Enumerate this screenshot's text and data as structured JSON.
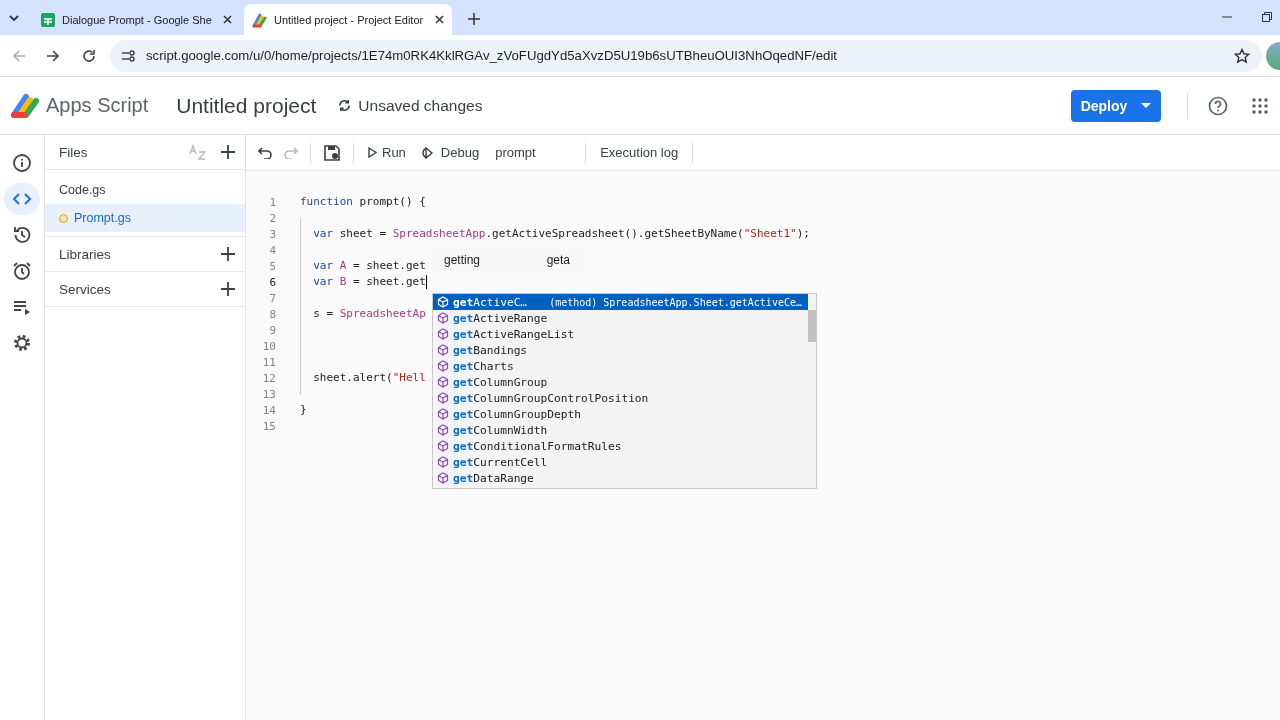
{
  "browser": {
    "tabs": [
      {
        "title": "Dialogue Prompt - Google She",
        "selected": false
      },
      {
        "title": "Untitled project - Project Editor",
        "selected": true
      }
    ],
    "url": "script.google.com/u/0/home/projects/1E74m0RK4KklRGAv_zVoFUgdYd5aXvzD5U19b6sUTBheuOUI3NhOqedNF/edit"
  },
  "header": {
    "product": "Apps Script",
    "project": "Untitled project",
    "status": "Unsaved changes",
    "deploy": "Deploy"
  },
  "rail": [
    {
      "selected": false
    },
    {
      "selected": true
    },
    {
      "selected": false
    },
    {
      "selected": false
    },
    {
      "selected": false
    },
    {
      "selected": false
    }
  ],
  "files_panel": {
    "title": "Files",
    "files": [
      {
        "name": "Code.gs",
        "selected": false,
        "unsaved": false
      },
      {
        "name": "Prompt.gs",
        "selected": true,
        "unsaved": true
      }
    ],
    "sections": [
      "Libraries",
      "Services"
    ]
  },
  "toolbar": {
    "undo_disabled": false,
    "redo_disabled": true,
    "run": "Run",
    "debug": "Debug",
    "function": "prompt",
    "log": "Execution log"
  },
  "editor": {
    "lines": [
      {
        "number": "1",
        "current": false,
        "tokens": [
          {
            "kind": "kw",
            "text": "function"
          },
          {
            "kind": "plain",
            "text": " prompt() "
          },
          {
            "kind": "brace",
            "text": "{"
          }
        ]
      },
      {
        "number": "2",
        "current": false
      },
      {
        "number": "3",
        "current": false,
        "tokens": [
          {
            "kind": "kw",
            "text": "  var"
          },
          {
            "kind": "plain",
            "text": " sheet = "
          },
          {
            "kind": "cls",
            "text": "SpreadsheetApp"
          },
          {
            "kind": "plain",
            "text": ".getActiveSpreadsheet().getSheetByName("
          },
          {
            "kind": "str",
            "text": "\"Sheet1\""
          },
          {
            "kind": "plain",
            "text": ");"
          }
        ]
      },
      {
        "number": "4",
        "current": false
      },
      {
        "number": "5",
        "current": false,
        "tokens": [
          {
            "kind": "kw",
            "text": "  var"
          },
          {
            "kind": "var",
            "text": " A"
          },
          {
            "kind": "plain",
            "text": " = sheet.get"
          }
        ]
      },
      {
        "number": "6",
        "current": true,
        "tokens": [
          {
            "kind": "kw",
            "text": "  var"
          },
          {
            "kind": "var",
            "text": " B"
          },
          {
            "kind": "plain",
            "text": " = sheet.get"
          }
        ]
      },
      {
        "number": "7",
        "current": false
      },
      {
        "number": "8",
        "current": false,
        "tokens": [
          {
            "kind": "plain",
            "text": "  s = "
          },
          {
            "kind": "cls",
            "text": "SpreadsheetAp"
          }
        ]
      },
      {
        "number": "9",
        "current": false
      },
      {
        "number": "10",
        "current": false
      },
      {
        "number": "11",
        "current": false
      },
      {
        "number": "12",
        "current": false,
        "tokens": [
          {
            "kind": "plain",
            "text": "  sheet.alert("
          },
          {
            "kind": "str",
            "text": "\"Hell"
          }
        ]
      },
      {
        "number": "13",
        "current": false
      },
      {
        "number": "14",
        "current": false,
        "tokens": [
          {
            "kind": "brace",
            "text": "}"
          }
        ]
      },
      {
        "number": "15",
        "current": false
      }
    ],
    "word_hints": [
      "getting",
      "geta"
    ],
    "suggest": {
      "detail": "(method) SpreadsheetApp.Sheet.getActiveCe…",
      "items": [
        {
          "match": "get",
          "rest": "ActiveC…",
          "selected": true
        },
        {
          "match": "get",
          "rest": "ActiveRange",
          "selected": false
        },
        {
          "match": "get",
          "rest": "ActiveRangeList",
          "selected": false
        },
        {
          "match": "get",
          "rest": "Bandings",
          "selected": false
        },
        {
          "match": "get",
          "rest": "Charts",
          "selected": false
        },
        {
          "match": "get",
          "rest": "ColumnGroup",
          "selected": false
        },
        {
          "match": "get",
          "rest": "ColumnGroupControlPosition",
          "selected": false
        },
        {
          "match": "get",
          "rest": "ColumnGroupDepth",
          "selected": false
        },
        {
          "match": "get",
          "rest": "ColumnWidth",
          "selected": false
        },
        {
          "match": "get",
          "rest": "ConditionalFormatRules",
          "selected": false
        },
        {
          "match": "get",
          "rest": "CurrentCell",
          "selected": false
        },
        {
          "match": "get",
          "rest": "DataRange",
          "selected": false
        }
      ]
    }
  }
}
